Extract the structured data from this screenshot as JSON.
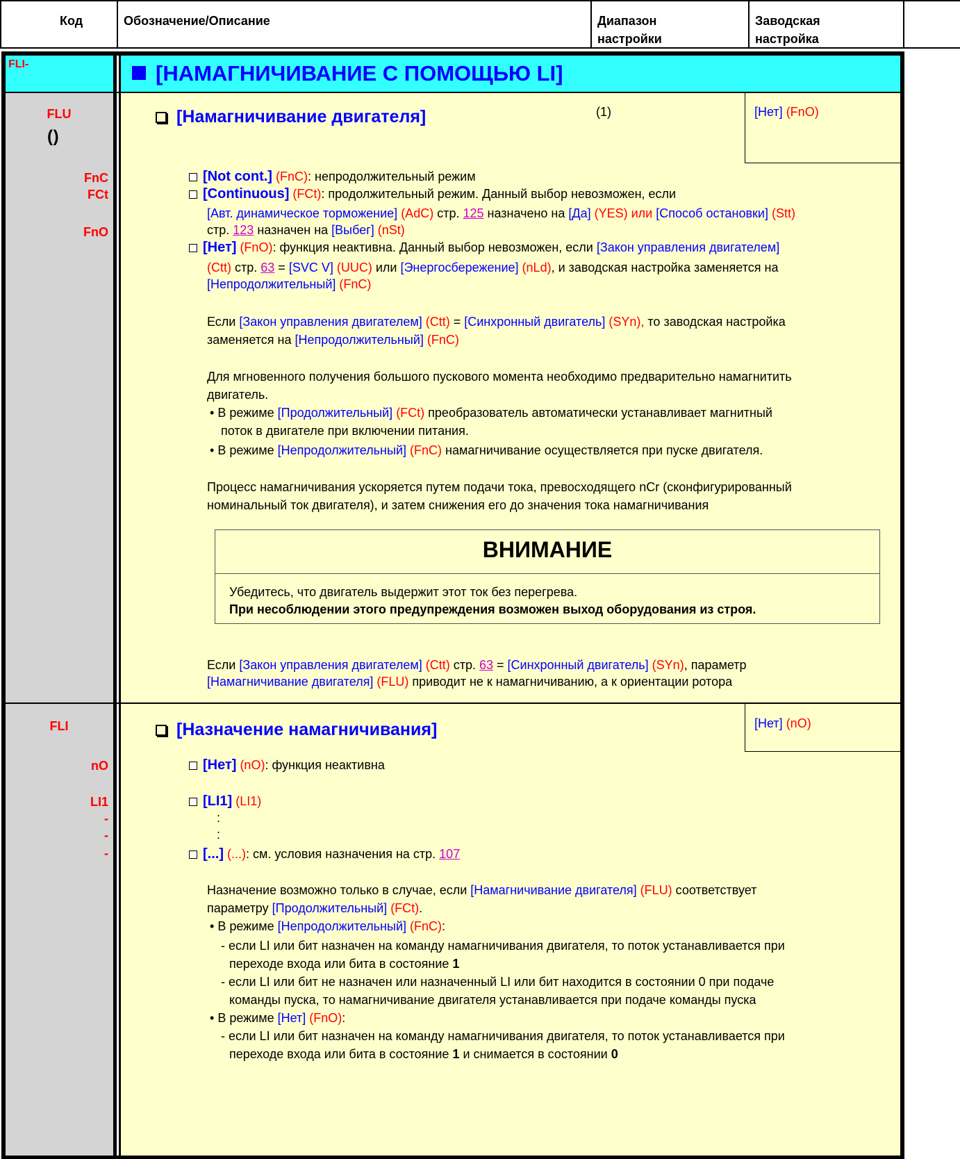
{
  "header": {
    "col_code": "Код",
    "col_desc": "Обозначение/Описание",
    "col_range_1": "Диапазон",
    "col_range_2": "настройки",
    "col_default_1": "Заводская",
    "col_default_2": "настройка"
  },
  "menu": {
    "code": "FLI-",
    "title": "[НАМАГНИЧИВАНИЕ С ПОМОЩЬЮ LI]"
  },
  "flu": {
    "code": "FLU",
    "title": "[Намагничивание двигателя]",
    "range_note": "(1)",
    "default_a": "[Нет]",
    "default_b": "(FnO)",
    "codes": [
      "FnC",
      "FCt",
      "FnO"
    ],
    "opt1_name": "[Not cont.]",
    "opt1_code": "(FnC)",
    "opt1_text": ":  непродолжительный режим",
    "opt2_name": "[Continuous]",
    "opt2_code": "(FCt)",
    "opt2_text": ": продолжительный режим. Данный выбор невозможен, если",
    "opt2_l2_a": "[Авт. динамическое торможение]",
    "opt2_l2_b": "(AdC)",
    "opt2_l2_c": " стр. ",
    "opt2_l2_page": "125",
    "opt2_l2_d": " назначено на ",
    "opt2_l2_e": "[Да]",
    "opt2_l2_f": " (YES) или ",
    "opt2_l2_g": "[Способ остановки]",
    "opt2_l2_h": " (Stt)",
    "opt2_l3_a": "стр. ",
    "opt2_l3_page": "123",
    "opt2_l3_b": " назначен на ",
    "opt2_l3_c": "[Выбег]",
    "opt2_l3_d": " (nSt)",
    "opt3_name": "[Нет]",
    "opt3_code": "(FnO)",
    "opt3_text": ": функция неактивна. Данный выбор невозможен, если ",
    "opt3_l1_e": "[Закон управления двигателем]",
    "opt3_l2_a": "(Ctt)",
    "opt3_l2_b": " стр. ",
    "opt3_l2_page": "63",
    "opt3_l2_c": " = ",
    "opt3_l2_d": "[SVC V]",
    "opt3_l2_e": " (UUC)",
    "opt3_l2_f": " или ",
    "opt3_l2_g": "[Энергосбережение]",
    "opt3_l2_h": " (nLd)",
    "opt3_l2_i": ", и заводская настройка заменяется на",
    "opt3_l3_a": "[Непродолжительный]",
    "opt3_l3_b": " (FnC)",
    "p1_a": "Если ",
    "p1_b": "[Закон управления двигателем]",
    "p1_c": " (Ctt)",
    "p1_d": " = ",
    "p1_e": "[Синхронный двигатель]",
    "p1_f": " (SYn),",
    "p1_g": " то заводская настройка",
    "p1_l2_a": "заменяется на ",
    "p1_l2_b": "[Непродолжительный]",
    "p1_l2_c": " (FnC)",
    "p2_l1": "Для мгновенного получения большого пускового момента необходимо предварительно намагнитить",
    "p2_l2": "двигатель.",
    "p2_b1_a": "В режиме ",
    "p2_b1_b": "[Продолжительный]",
    "p2_b1_c": " (FCt)",
    "p2_b1_d": " преобразователь автоматически устанавливает магнитный",
    "p2_b1_l2": "поток в двигателе при включении питания.",
    "p2_b2_a": "В режиме ",
    "p2_b2_b": "[Непродолжительный]",
    "p2_b2_c": " (FnC)",
    "p2_b2_d": " намагничивание осуществляется при пуске двигателя.",
    "p3_l1": "Процесс намагничивания ускоряется путем подачи тока, превосходящего nCr (сконфигурированный",
    "p3_l2": "номинальный ток двигателя), и затем снижения его до значения тока намагничивания",
    "warn_title": "ВНИМАНИЕ",
    "warn_l1": "Убедитесь, что двигатель выдержит этот ток без перегрева.",
    "warn_l2": "При несоблюдении этого предупреждения возможен выход оборудования из строя.",
    "p4_a": "Если ",
    "p4_b": "[Закон управления двигателем]",
    "p4_c": " (Ctt)",
    "p4_d": " стр. ",
    "p4_page": "63",
    "p4_e": " = ",
    "p4_f": "[Синхронный двигатель]",
    "p4_g": " (SYn)",
    "p4_h": ", параметр",
    "p4_l2_a": "[Намагничивание двигателя]",
    "p4_l2_b": " (FLU)",
    "p4_l2_c": " приводит не к намагничиванию, а к ориентации ротора"
  },
  "fli": {
    "code": "FLI",
    "codes": [
      "nO",
      "LI1",
      "-",
      "-",
      "-"
    ],
    "title": "[Назначение намагничивания]",
    "default_a": "[Нет]",
    "default_b": "(nO)",
    "opt1_name": "[Нет]",
    "opt1_code": "(nO)",
    "opt1_text": ": функция неактивна",
    "opt2_name": "[LI1]",
    "opt2_code": "(LI1)",
    "dots": ":",
    "opt3_name": "[...]",
    "opt3_code": "(...)",
    "opt3_text": ": см. условия назначения на стр. ",
    "opt3_page": "107",
    "p1_a": "Назначение возможно только в случае, если ",
    "p1_b": "[Намагничивание двигателя]",
    "p1_c": " (FLU)",
    "p1_d": " соответствует",
    "p1_l2_a": "параметру ",
    "p1_l2_b": "[Продолжительный]",
    "p1_l2_c": " (FCt)",
    "p1_l2_d": ".",
    "b1_a": "В режиме ",
    "b1_b": "[Непродолжительный]",
    "b1_c": " (FnC)",
    "b1_d": ":",
    "b1_s1_l1": "- если LI или бит назначен на команду намагничивания двигателя, то поток устанавливается при",
    "b1_s1_l2a": "переходе входа или бита в состояние ",
    "b1_s1_l2b": "1",
    "b1_s2_l1": "- если LI или бит не назначен или назначенный LI или бит находится в состоянии 0 при подаче",
    "b1_s2_l2": "команды пуска, то намагничивание двигателя устанавливается при подаче команды пуска",
    "b2_a": "В режиме ",
    "b2_b": "[Нет]",
    "b2_c": " (FnO)",
    "b2_d": ":",
    "b2_s1_l1": "- если LI или бит назначен на команду намагничивания двигателя, то поток устанавливается при",
    "b2_s1_l2a": "переходе входа или бита в состояние ",
    "b2_s1_l2b": "1",
    "b2_s1_l2c": " и снимается в состоянии ",
    "b2_s1_l2d": "0"
  },
  "colors": {
    "menu_row": "#33ffff",
    "body_yellow": "#ffffcc",
    "code_gray": "#d4d4d4",
    "code_red": "#ff0000",
    "value_blue": "#0000ff",
    "link_magenta": "#cc00cc"
  }
}
